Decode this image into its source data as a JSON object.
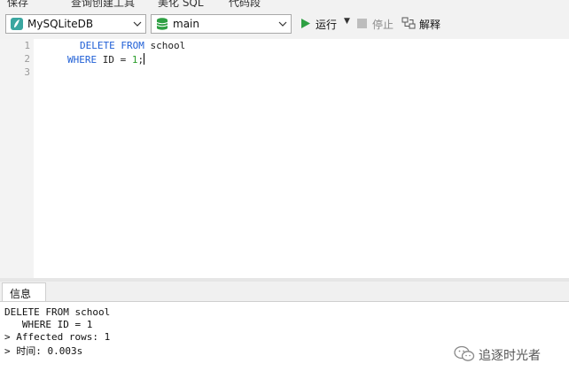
{
  "top_toolbar": {
    "items": [
      "保存",
      "查询创建工具",
      "美化 SQL",
      "代码段"
    ]
  },
  "connection_bar": {
    "connection": "MySQLiteDB",
    "database": "main",
    "run_label": "运行",
    "stop_label": "停止",
    "explain_label": "解释"
  },
  "editor": {
    "line_numbers": [
      "1",
      "2",
      "3"
    ],
    "line1": {
      "kw1": "DELETE",
      "kw2": "FROM",
      "ident": "school"
    },
    "line2": {
      "kw1": "WHERE",
      "ident": "ID",
      "op": "=",
      "num": "1",
      "end": ";"
    }
  },
  "info_panel": {
    "tab_label": "信息",
    "lines": [
      "DELETE FROM school",
      "   WHERE ID = 1",
      "> Affected rows: 1",
      "> 时间: 0.003s"
    ]
  },
  "watermark": {
    "text": "追逐时光者"
  }
}
